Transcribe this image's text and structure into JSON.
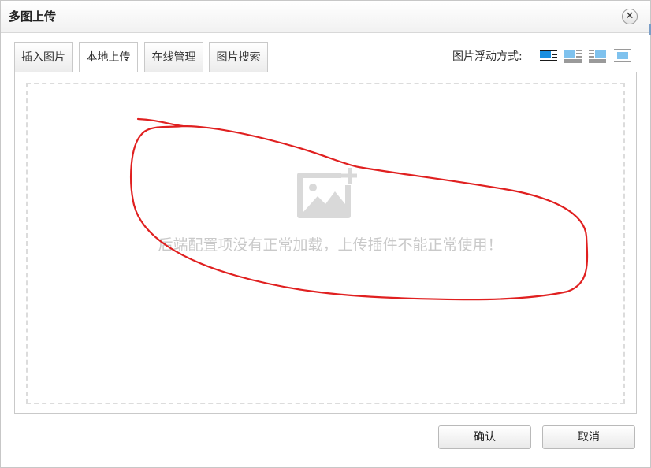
{
  "dialog": {
    "title": "多图上传",
    "close_symbol": "✕"
  },
  "tabs": [
    {
      "label": "插入图片",
      "active": false
    },
    {
      "label": "本地上传",
      "active": true
    },
    {
      "label": "在线管理",
      "active": false
    },
    {
      "label": "图片搜索",
      "active": false
    }
  ],
  "float_options": {
    "label": "图片浮动方式:",
    "icons": [
      "float-none-icon",
      "float-left-icon",
      "float-right-icon",
      "float-center-icon"
    ],
    "selected": 0
  },
  "upload_area": {
    "icon": "image-add-icon",
    "message": "后端配置项没有正常加载，上传插件不能正常使用！"
  },
  "buttons": {
    "confirm": "确认",
    "cancel": "取消"
  },
  "colors": {
    "annotation": "#e02020",
    "selected_icon": "#1a8fe0"
  }
}
